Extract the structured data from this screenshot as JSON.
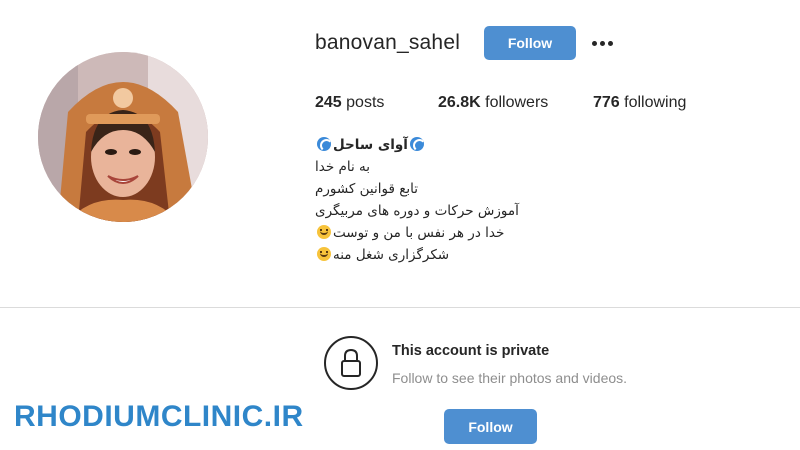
{
  "profile": {
    "username": "banovan_sahel",
    "follow_label": "Follow",
    "more_options_icon": "more-horizontal-icon",
    "avatar_icon": "profile-photo"
  },
  "stats": {
    "posts_count": "245",
    "posts_label": " posts",
    "followers_count": "26.8K",
    "followers_label": " followers",
    "following_count": "776",
    "following_label": " following"
  },
  "bio": {
    "title": "آوای ساحل",
    "lines": [
      "به نام خدا",
      "تابع قوانین کشورم",
      "آموزش حرکات و دوره های مربیگری",
      "خدا در هر نفس با من و توست",
      "شکرگزاری شغل منه"
    ],
    "emoji_wave": "water-wave-icon",
    "emoji_smile": "smiling-face-icon"
  },
  "private_section": {
    "icon": "lock-icon",
    "title": "This account is private",
    "subtitle": "Follow to see their photos and videos.",
    "follow_label": "Follow"
  },
  "watermark": {
    "text": "RHODIUMCLINIC.IR"
  },
  "colors": {
    "accent_button": "#4e8fd1",
    "watermark": "#2f86c9",
    "text_primary": "#262626",
    "text_secondary": "#8e8e8e"
  }
}
